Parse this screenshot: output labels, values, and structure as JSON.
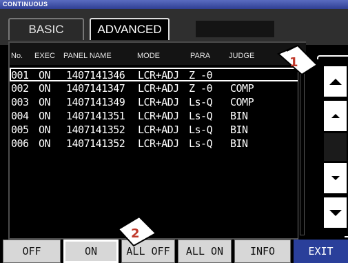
{
  "window": {
    "title": "CONTINUOUS"
  },
  "tabs": [
    {
      "label": "BASIC",
      "active": false
    },
    {
      "label": "ADVANCED",
      "active": true
    }
  ],
  "list": {
    "headers": [
      "No.",
      "EXEC",
      "PANEL NAME",
      "MODE",
      "PARA",
      "JUDGE"
    ],
    "rows": [
      {
        "no": "001",
        "exec": "ON",
        "panel": "1407141346",
        "mode": "LCR+ADJ",
        "para": "Z -θ",
        "judge": "",
        "selected": true
      },
      {
        "no": "002",
        "exec": "ON",
        "panel": "1407141347",
        "mode": "LCR+ADJ",
        "para": "Z -θ",
        "judge": "COMP"
      },
      {
        "no": "003",
        "exec": "ON",
        "panel": "1407141349",
        "mode": "LCR+ADJ",
        "para": "Ls-Q",
        "judge": "COMP"
      },
      {
        "no": "004",
        "exec": "ON",
        "panel": "1407141351",
        "mode": "LCR+ADJ",
        "para": "Ls-Q",
        "judge": "BIN"
      },
      {
        "no": "005",
        "exec": "ON",
        "panel": "1407141352",
        "mode": "LCR+ADJ",
        "para": "Ls-Q",
        "judge": "BIN"
      },
      {
        "no": "006",
        "exec": "ON",
        "panel": "1407141352",
        "mode": "LCR+ADJ",
        "para": "Ls-Q",
        "judge": "BIN"
      }
    ]
  },
  "scroll_buttons": [
    "page-up-icon",
    "line-up-icon",
    "line-down-icon",
    "page-down-icon"
  ],
  "bottom_buttons": {
    "off": "OFF",
    "on": "ON",
    "all_off": "ALL OFF",
    "all_on": "ALL ON",
    "info": "INFO",
    "exit": "EXIT"
  },
  "callouts": {
    "one": "1",
    "two": "2"
  },
  "colors": {
    "title_bar": "#2f3f93",
    "exit_button": "#2a3f9a",
    "callout_number": "#c0392b"
  }
}
